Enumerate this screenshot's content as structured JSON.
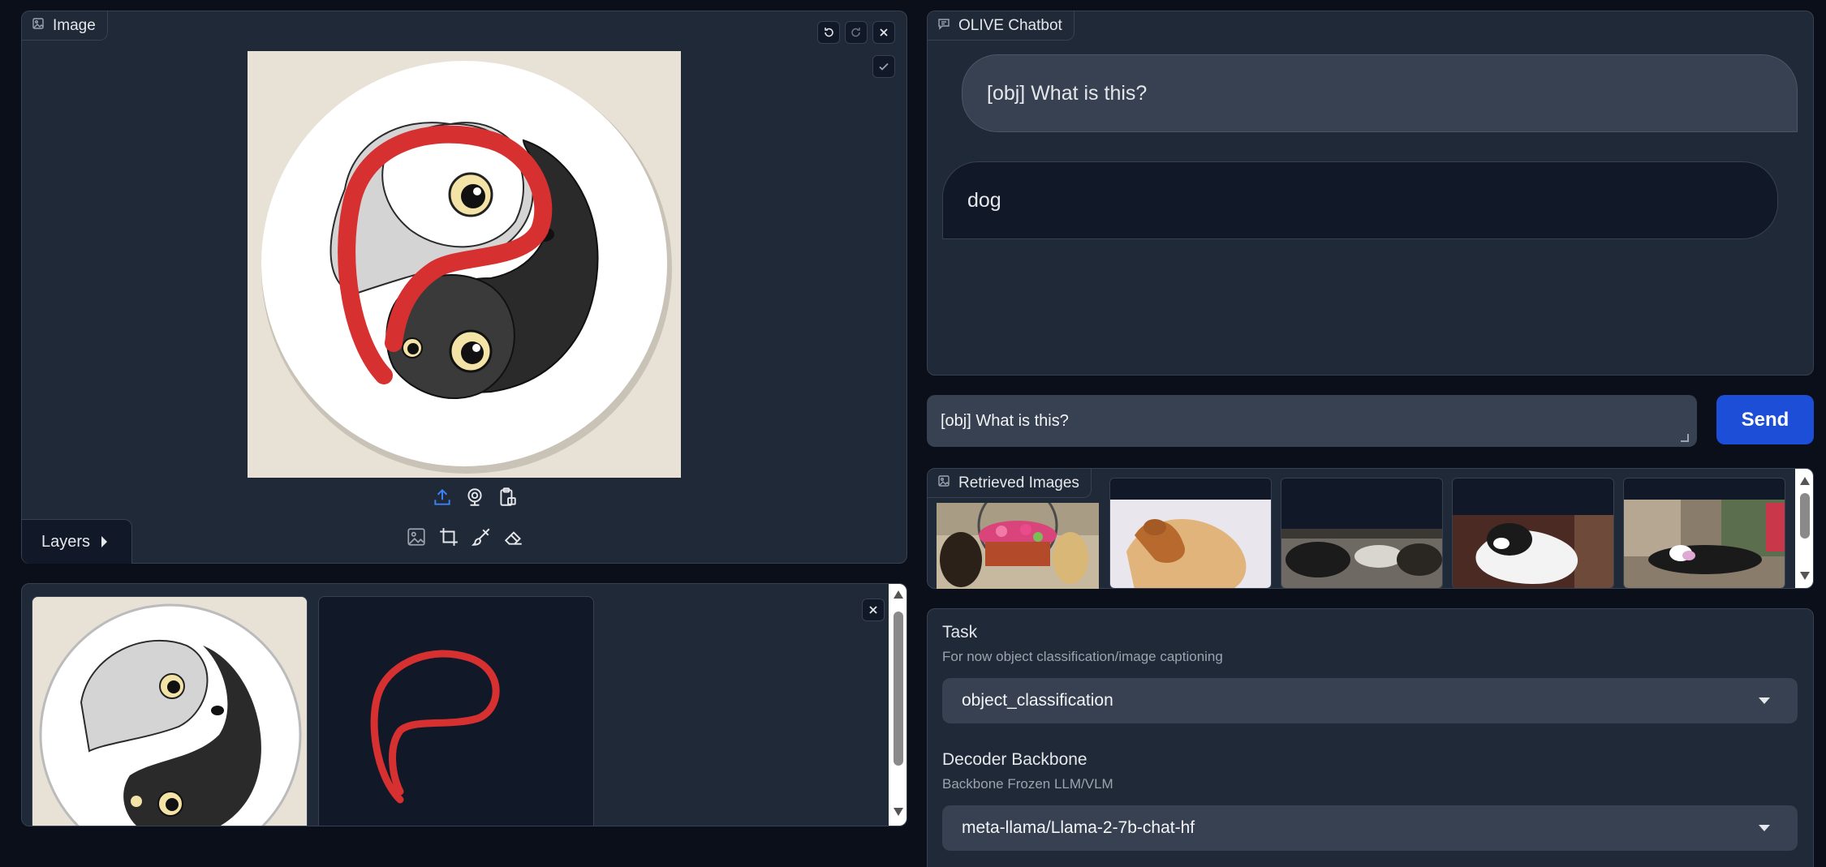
{
  "image_editor": {
    "label": "Image",
    "layers_label": "Layers"
  },
  "chatbot": {
    "label": "OLIVE Chatbot",
    "messages": [
      {
        "role": "user",
        "text": "[obj] What is this?"
      },
      {
        "role": "bot",
        "text": "dog"
      }
    ]
  },
  "input": {
    "value": "[obj] What is this?",
    "send_label": "Send"
  },
  "retrieved": {
    "label": "Retrieved Images",
    "images": [
      "dogs-with-flower-basket",
      "dog-on-couch",
      "cats-on-floor",
      "dog-on-bed",
      "black-cat-on-carpet"
    ]
  },
  "settings": {
    "task": {
      "title": "Task",
      "info": "For now object classification/image captioning",
      "value": "object_classification"
    },
    "decoder": {
      "title": "Decoder Backbone",
      "info": "Backbone Frozen LLM/VLM",
      "value": "meta-llama/Llama-2-7b-chat-hf"
    }
  },
  "colors": {
    "background": "#0b0f19",
    "panel": "#1f2937",
    "accent": "#1d4ed8",
    "scribble": "#d63031"
  }
}
